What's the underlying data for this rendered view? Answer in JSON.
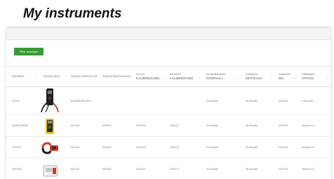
{
  "page": {
    "title": "My instruments",
    "filter_button": "Filter anzeigen"
  },
  "table": {
    "headers": [
      {
        "small": "SERIENNR.",
        "big": ""
      },
      {
        "small": "PRODUKTBILD",
        "big": ""
      },
      {
        "small": "PRODUKTHERSTELLER",
        "big": ""
      },
      {
        "small": "PRODUKTBEZEICHNUNG",
        "big": ""
      },
      {
        "small": "LETZTE",
        "big": "KALIBRIERUNG"
      },
      {
        "small": "NÄCHSTE",
        "big": "KALIBRIERUNG"
      },
      {
        "small": "KALIBRIERUNGS-",
        "big": "INTERVALL"
      },
      {
        "small": "GARANTIE-",
        "big": "ZEITRAUM"
      },
      {
        "small": "GARANTIE",
        "big": "BIS"
      },
      {
        "small": "FIRMWARE-",
        "big": "STATUS"
      }
    ],
    "rows": [
      {
        "serial": "23726",
        "manufacturer": "BUSINESSCOCO",
        "name": "",
        "last": "",
        "next": "",
        "interval": "12 Monate",
        "warranty": "48 Monate",
        "until": "2019-02",
        "status": "3.023.005"
      },
      {
        "serial": "GMUH3183FE",
        "manufacturer": "KIOXIA",
        "name": "003/251",
        "last": "2015-04",
        "next": "2020-11",
        "interval": "24 Monate",
        "warranty": "36 Monate",
        "until": "2019-03",
        "status": "Version 3.5"
      },
      {
        "serial": "GP9737",
        "manufacturer": "KIOXIA",
        "name": "003/251",
        "last": "2015-04",
        "next": "2020-11",
        "interval": "24 Monate",
        "warranty": "36 Monate",
        "until": "2019-03",
        "status": "Version 3.5"
      },
      {
        "serial": "QH9726",
        "manufacturer": "KIOXIA",
        "name": "003/251",
        "last": "2016-02",
        "next": "2020-11",
        "interval": "24 Monate",
        "warranty": "36 Monate",
        "until": "2019-03",
        "status": "Version 3.5"
      }
    ]
  },
  "colors": {
    "accent_green": "#3a9a35",
    "meter_yellow": "#e8c21a",
    "clamp_red": "#d23a2c"
  }
}
